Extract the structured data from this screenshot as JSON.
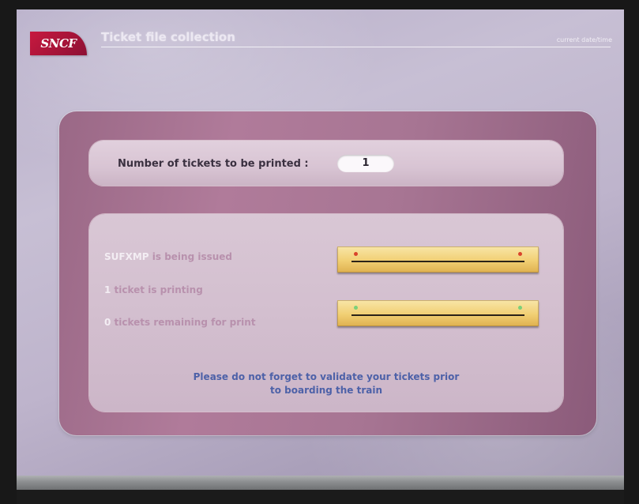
{
  "header": {
    "logo_text": "SNCF",
    "title": "Ticket file collection",
    "datetime": "current date/time"
  },
  "ticket_count": {
    "label": "Number of tickets to be printed :",
    "value": "1"
  },
  "status": {
    "issuing": {
      "highlight": "SUFXMP",
      "text": " is being issued"
    },
    "printing": {
      "highlight": "1",
      "text": " ticket is printing"
    },
    "remaining": {
      "highlight": "0",
      "text": " tickets remaining for print"
    }
  },
  "progress": {
    "issuing_dot_color": "#d9442b",
    "printing_dot_color": "#7bd07a"
  },
  "notice": {
    "line1": "Please do not forget to validate your tickets prior",
    "line2": "to boarding the train"
  }
}
